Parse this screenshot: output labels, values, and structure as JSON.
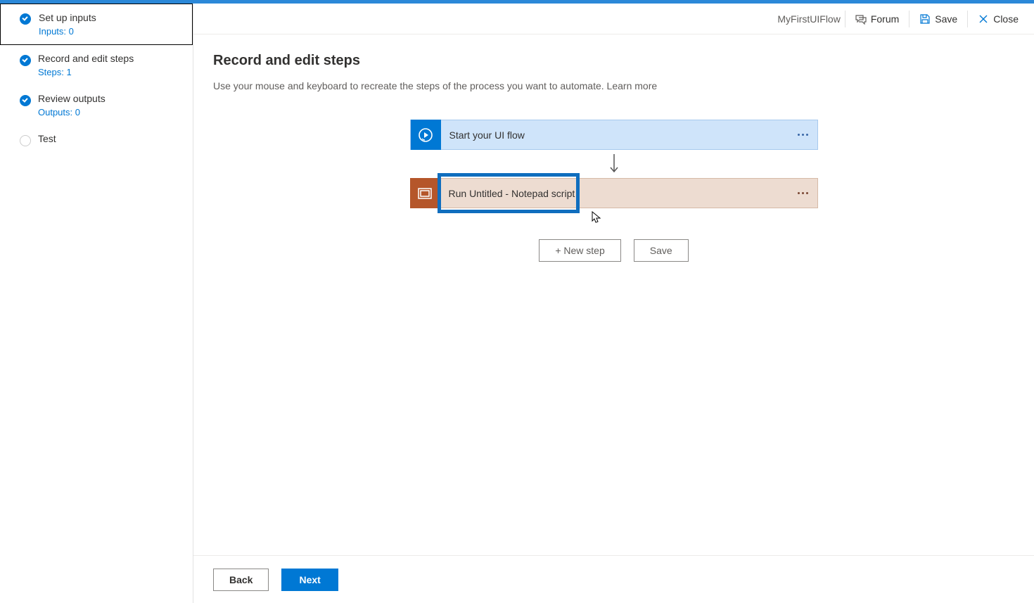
{
  "header": {
    "flow_name": "MyFirstUIFlow",
    "forum": "Forum",
    "save": "Save",
    "close": "Close"
  },
  "sidebar": {
    "steps": [
      {
        "label": "Set up inputs",
        "sub": "Inputs: 0",
        "done": true,
        "active": true
      },
      {
        "label": "Record and edit steps",
        "sub": "Steps: 1",
        "done": true,
        "active": false
      },
      {
        "label": "Review outputs",
        "sub": "Outputs: 0",
        "done": true,
        "active": false
      },
      {
        "label": "Test",
        "sub": "",
        "done": false,
        "active": false
      }
    ]
  },
  "page": {
    "title": "Record and edit steps",
    "description": "Use your mouse and keyboard to recreate the steps of the process you want to automate.  ",
    "learn_more": "Learn more"
  },
  "cards": {
    "start": "Start your UI flow",
    "script": "Run Untitled - Notepad script"
  },
  "actions": {
    "new_step": "+ New step",
    "save": "Save"
  },
  "footer": {
    "back": "Back",
    "next": "Next"
  }
}
